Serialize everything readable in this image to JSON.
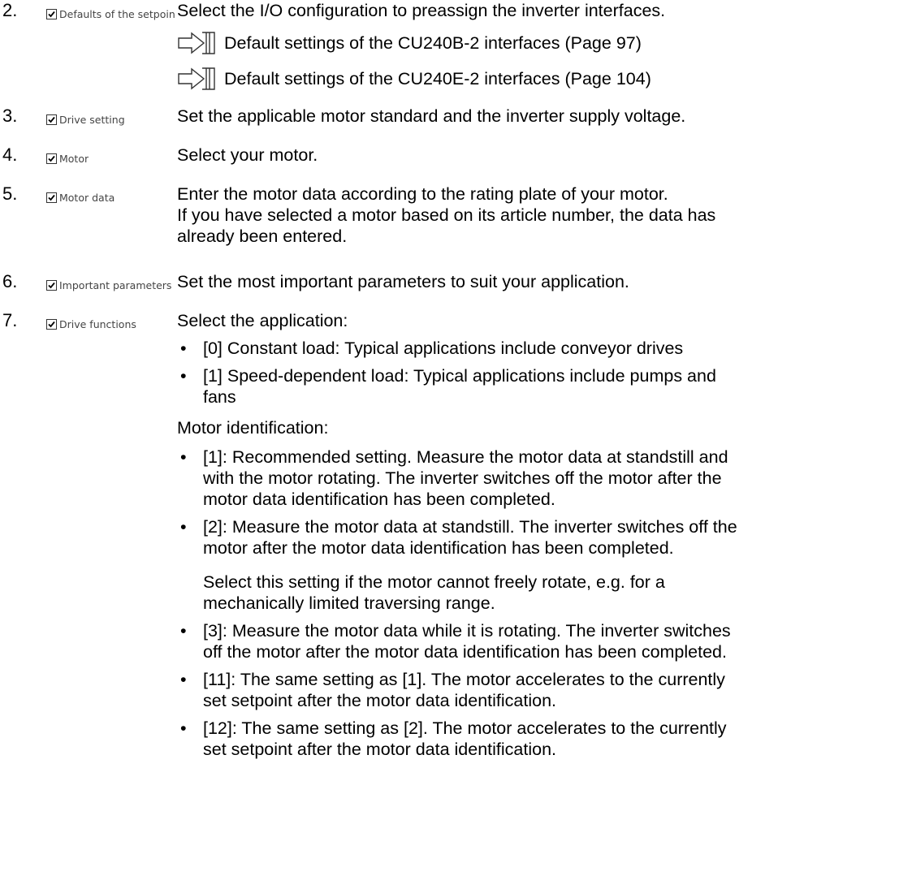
{
  "steps": [
    {
      "number": "2.",
      "checkbox_label": "Defaults of the setpoin",
      "text": "Select the I/O configuration to preassign the inverter interfaces.",
      "references": [
        "Default settings of the CU240B-2 interfaces (Page 97)",
        "Default settings of the CU240E-2 interfaces (Page 104)"
      ]
    },
    {
      "number": "3.",
      "checkbox_label": "Drive setting",
      "text": "Set the applicable motor standard and the inverter supply voltage."
    },
    {
      "number": "4.",
      "checkbox_label": "Motor",
      "text": "Select your motor."
    },
    {
      "number": "5.",
      "checkbox_label": "Motor data",
      "text_lines": [
        "Enter the motor data according to the rating plate of your motor.",
        "If you have selected a motor based on its article number, the data has already been entered."
      ]
    },
    {
      "number": "6.",
      "checkbox_label": "Important parameters",
      "text": "Set the most important parameters to suit your application."
    },
    {
      "number": "7.",
      "checkbox_label": "Drive functions",
      "application_heading": "Select the application:",
      "application_options": [
        "[0] Constant load: Typical applications include conveyor drives",
        "[1] Speed-dependent load: Typical applications include pumps and fans"
      ],
      "identification_heading": "Motor identification:",
      "identification_options": [
        "[1]: Recommended setting. Measure the motor data at standstill and with the motor rotating. The inverter switches off the motor after the motor data identification has been completed.",
        "[2]: Measure the motor data at standstill. The inverter switches off the motor after the motor data identification has been completed.",
        "[3]: Measure the motor data while it is rotating. The inverter switches off the motor after the motor data identification has been completed.",
        "[11]: The same setting as [1]. The motor accelerates to the currently set setpoint after the motor data identification.",
        "[12]: The same setting as [2]. The motor accelerates to the currently set setpoint after the motor data identification."
      ],
      "identification_note": "Select this setting if the motor cannot freely rotate, e.g. for a mechanically limited traversing range."
    }
  ],
  "icons": {
    "checkbox": "checkbox-checked-icon",
    "reference": "page-reference-arrow-icon"
  }
}
